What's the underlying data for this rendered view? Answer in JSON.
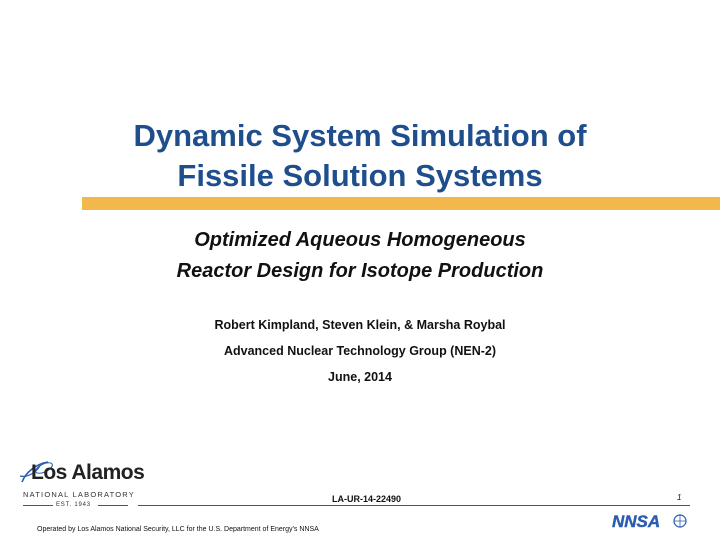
{
  "slide": {
    "title_lines": [
      "Dynamic System Simulation of",
      "Fissile Solution Systems"
    ],
    "subtitle_lines": [
      "Optimized Aqueous Homogeneous",
      "Reactor Design for Isotope Production"
    ],
    "authors": "Robert Kimpland, Steven Klein, & Marsha Roybal",
    "group": "Advanced Nuclear Technology Group (NEN-2)",
    "date": "June, 2014",
    "report_number": "LA-UR-14-22490",
    "page_number": "1",
    "footer_text": "Operated by Los Alamos National Security, LLC for the U.S. Department of Energy’s NNSA"
  },
  "logo": {
    "name": "Los Alamos",
    "subtitle": "NATIONAL LABORATORY",
    "established": "EST. 1943"
  },
  "nnsa_logo": {
    "text": "NNSA"
  },
  "colors": {
    "title": "#1f4e8c",
    "accent_bar": "#f2b84b",
    "logo_blue": "#2a5db0"
  }
}
